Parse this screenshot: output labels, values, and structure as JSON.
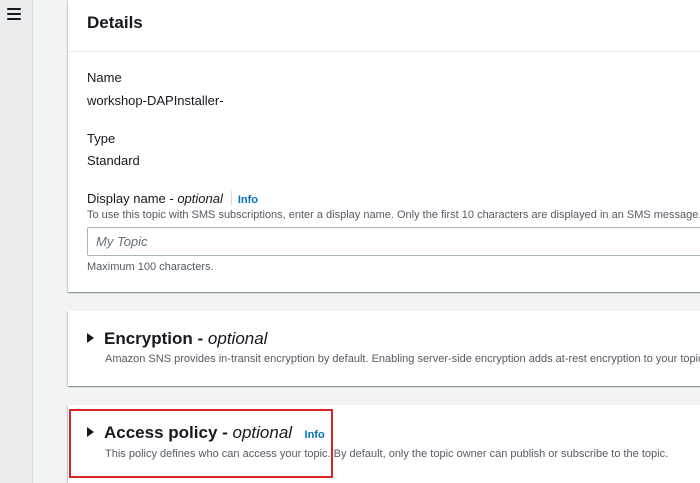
{
  "nav": {
    "menu_icon": "hamburger-menu-icon"
  },
  "details": {
    "title": "Details",
    "name_label": "Name",
    "name_value": "workshop-DAPInstaller-",
    "type_label": "Type",
    "type_value": "Standard",
    "display_name_label": "Display name - ",
    "display_name_optional": "optional",
    "display_name_info": "Info",
    "display_name_desc": "To use this topic with SMS subscriptions, enter a display name. Only the first 10 characters are displayed in an SMS message.",
    "display_name_placeholder": "My Topic",
    "display_name_value": "",
    "display_name_hint": "Maximum 100 characters."
  },
  "encryption": {
    "title": "Encryption - ",
    "optional": "optional",
    "desc": "Amazon SNS provides in-transit encryption by default. Enabling server-side encryption adds at-rest encryption to your topic."
  },
  "access_policy": {
    "title": "Access policy - ",
    "optional": "optional",
    "info": "Info",
    "desc": "This policy defines who can access your topic. By default, only the topic owner can publish or subscribe to the topic."
  },
  "colors": {
    "background": "#f2f3f3",
    "panel": "#ffffff",
    "link": "#0073bb",
    "highlight": "#d92424",
    "text": "#16191f",
    "secondary_text": "#545b64"
  }
}
